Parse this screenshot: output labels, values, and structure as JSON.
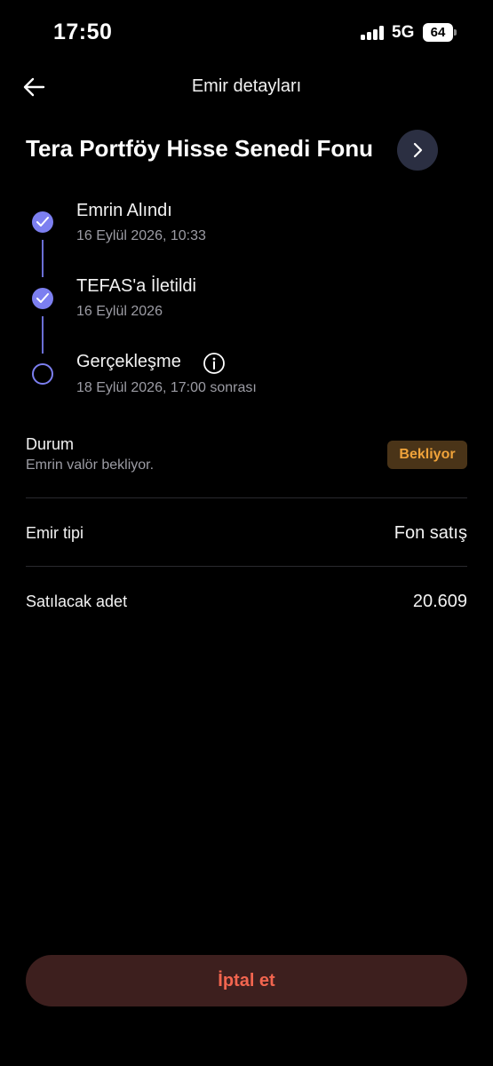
{
  "status_bar": {
    "time": "17:50",
    "network": "5G",
    "battery": "64"
  },
  "header": {
    "back_icon": "arrow-left-icon",
    "title": "Emir detayları"
  },
  "fund": {
    "name": "Tera Portföy Hisse Senedi Fonu",
    "chevron_icon": "chevron-right-icon"
  },
  "timeline": {
    "steps": [
      {
        "title": "Emrin Alındı",
        "subtitle": "16 Eylül 2026, 10:33",
        "state": "done",
        "icon": "check-icon"
      },
      {
        "title": "TEFAS'a İletildi",
        "subtitle": "16 Eylül 2026",
        "state": "done",
        "icon": "check-icon"
      },
      {
        "title": "Gerçekleşme",
        "subtitle": "18 Eylül 2026, 17:00 sonrası",
        "state": "pending",
        "icon": "info-icon"
      }
    ],
    "accent": "#7c7ff0"
  },
  "status": {
    "label": "Durum",
    "description": "Emrin valör bekliyor.",
    "badge": "Bekliyor",
    "badge_color": "#f0a33a"
  },
  "details": [
    {
      "label": "Emir tipi",
      "value": "Fon satış"
    },
    {
      "label": "Satılacak adet",
      "value": "20.609"
    }
  ],
  "actions": {
    "cancel_label": "İptal et",
    "cancel_color": "#f2654f"
  }
}
